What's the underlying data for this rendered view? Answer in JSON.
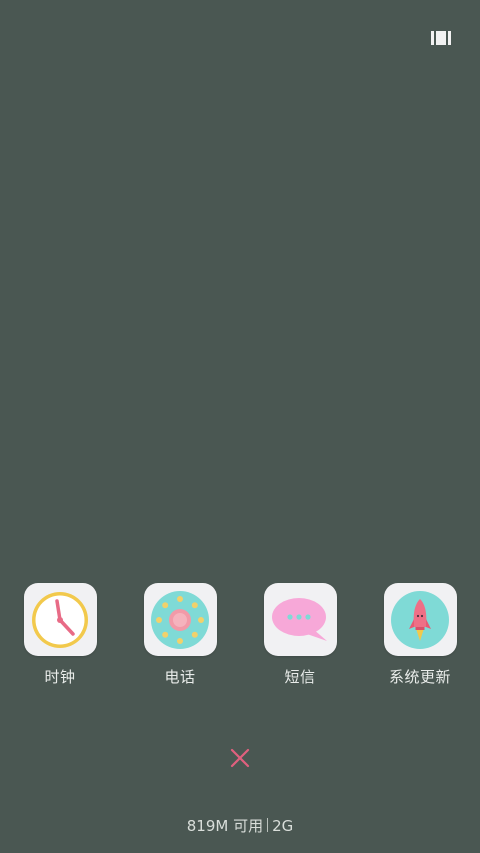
{
  "top_button": {
    "icon": "recents-menu-icon"
  },
  "apps": [
    {
      "label": "时钟",
      "icon": "clock-icon"
    },
    {
      "label": "电话",
      "icon": "phone-dial-icon"
    },
    {
      "label": "短信",
      "icon": "message-bubble-icon"
    },
    {
      "label": "系统更新",
      "icon": "rocket-icon"
    }
  ],
  "close": {
    "icon": "close-icon",
    "color": "#e0607e"
  },
  "memory": {
    "available": "819M 可用",
    "total": "2G"
  },
  "colors": {
    "background": "#4a5752",
    "tile": "#f1f1f3",
    "clock_ring": "#f2c94c",
    "clock_hand": "#e86b86",
    "phone_teal": "#7fdad6",
    "phone_pink": "#f29aa8",
    "message_pink": "#f7a8d8",
    "rocket_bg": "#7fdad6",
    "rocket_body": "#ef6f86"
  }
}
